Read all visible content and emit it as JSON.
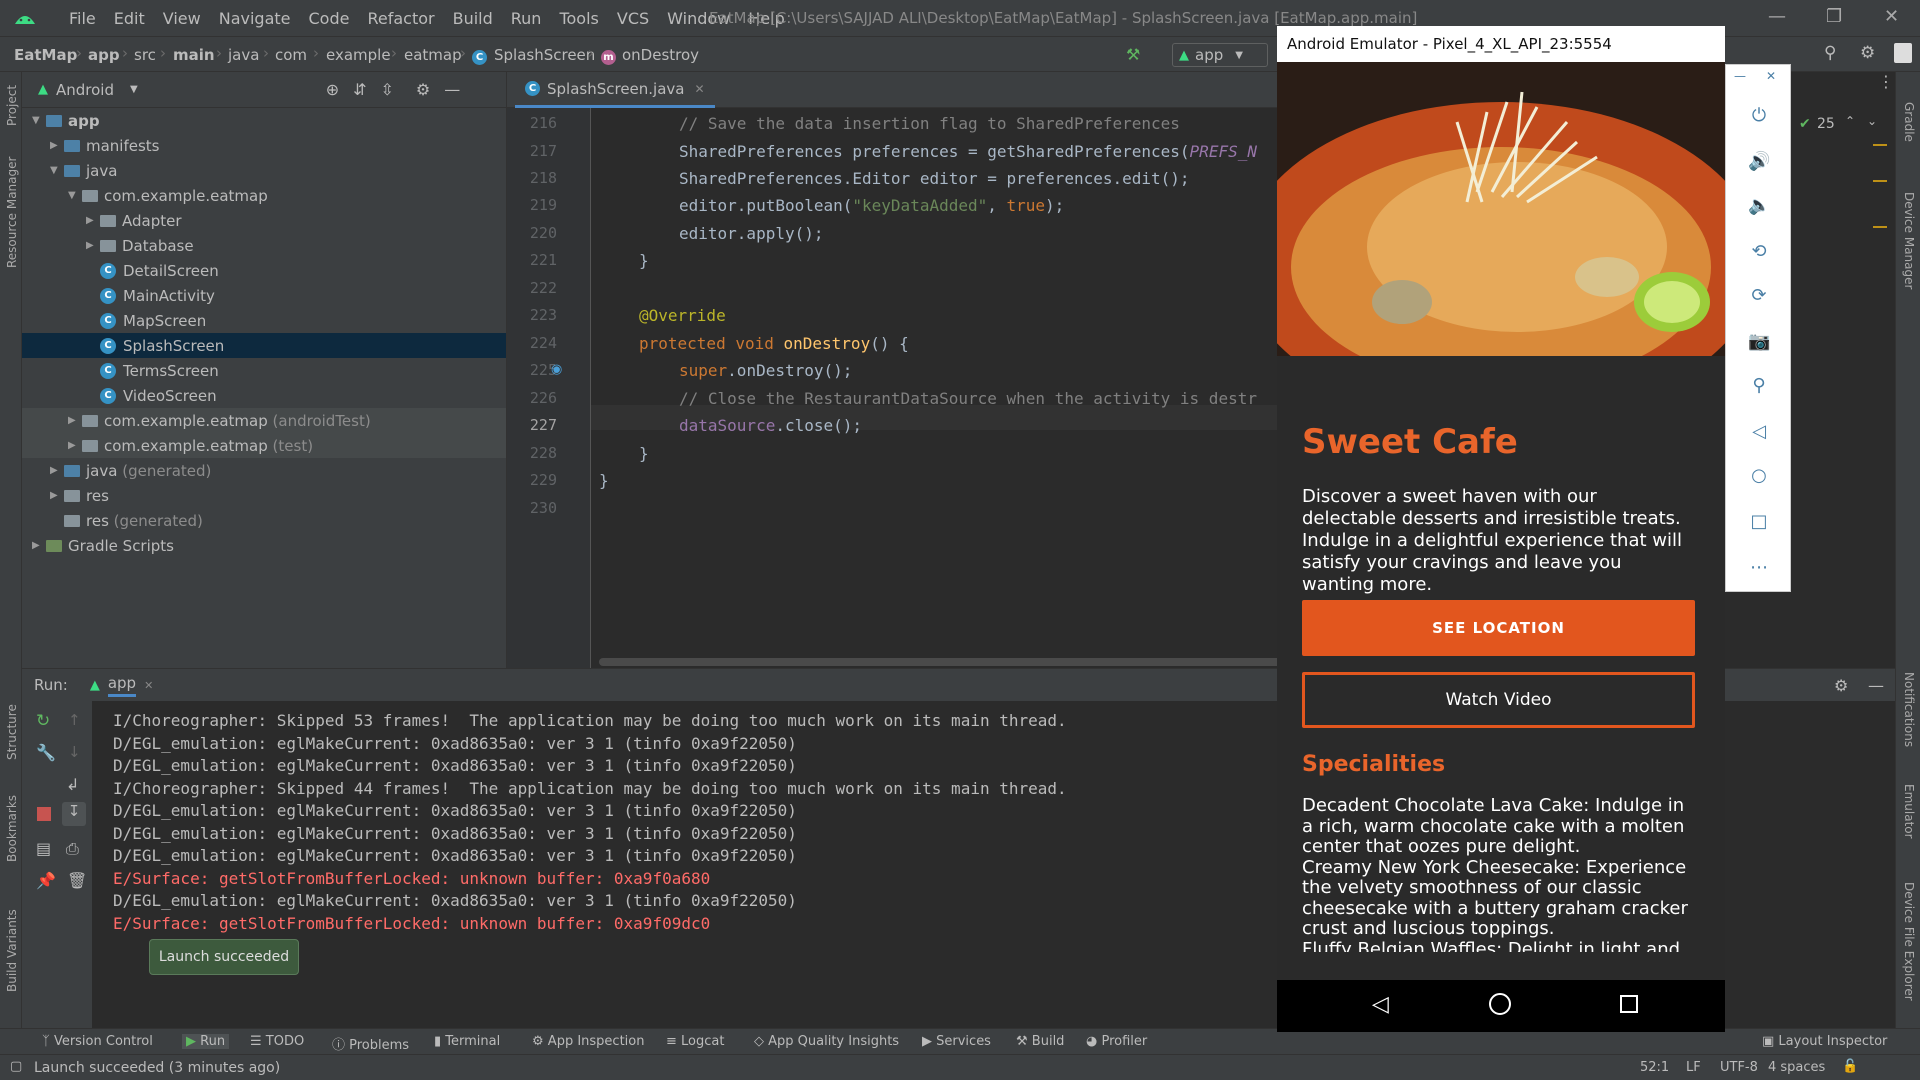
{
  "menubar": {
    "items": [
      "File",
      "Edit",
      "View",
      "Navigate",
      "Code",
      "Refactor",
      "Build",
      "Run",
      "Tools",
      "VCS",
      "Window",
      "Help"
    ],
    "window_title": "EatMap [C:\\Users\\SAJJAD ALI\\Desktop\\EatMap\\EatMap] - SplashScreen.java [EatMap.app.main]"
  },
  "breadcrumb": {
    "items": [
      "EatMap",
      "app",
      "src",
      "main",
      "java",
      "com",
      "example",
      "eatmap",
      "SplashScreen",
      "onDestroy"
    ],
    "run_config": "app"
  },
  "project": {
    "view_label": "Android",
    "tree": [
      {
        "label": "app",
        "depth": 0,
        "type": "module"
      },
      {
        "label": "manifests",
        "depth": 1,
        "type": "folder"
      },
      {
        "label": "java",
        "depth": 1,
        "type": "folder"
      },
      {
        "label": "com.example.eatmap",
        "depth": 2,
        "type": "package"
      },
      {
        "label": "Adapter",
        "depth": 3,
        "type": "package"
      },
      {
        "label": "Database",
        "depth": 3,
        "type": "package"
      },
      {
        "label": "DetailScreen",
        "depth": 3,
        "type": "class"
      },
      {
        "label": "MainActivity",
        "depth": 3,
        "type": "class"
      },
      {
        "label": "MapScreen",
        "depth": 3,
        "type": "class"
      },
      {
        "label": "SplashScreen",
        "depth": 3,
        "type": "class"
      },
      {
        "label": "TermsScreen",
        "depth": 3,
        "type": "class"
      },
      {
        "label": "VideoScreen",
        "depth": 3,
        "type": "class"
      },
      {
        "label": "com.example.eatmap",
        "suffix": "(androidTest)",
        "depth": 2,
        "type": "package"
      },
      {
        "label": "com.example.eatmap",
        "suffix": "(test)",
        "depth": 2,
        "type": "package"
      },
      {
        "label": "java",
        "suffix": "(generated)",
        "depth": 1,
        "type": "folder"
      },
      {
        "label": "res",
        "depth": 1,
        "type": "folder"
      },
      {
        "label": "res",
        "suffix": "(generated)",
        "depth": 1,
        "type": "folder"
      },
      {
        "label": "Gradle Scripts",
        "depth": 0,
        "type": "gradle"
      }
    ]
  },
  "editor": {
    "tab_label": "SplashScreen.java",
    "line_numbers": [
      "216",
      "217",
      "218",
      "219",
      "220",
      "221",
      "222",
      "223",
      "224",
      "225",
      "226",
      "227",
      "228",
      "229",
      "230"
    ],
    "inspection_count": "25"
  },
  "run": {
    "label": "Run:",
    "config": "app",
    "log": [
      {
        "level": "I",
        "text": "I/Choreographer: Skipped 53 frames!  The application may be doing too much work on its main thread."
      },
      {
        "level": "D",
        "text": "D/EGL_emulation: eglMakeCurrent: 0xad8635a0: ver 3 1 (tinfo 0xa9f22050)"
      },
      {
        "level": "D",
        "text": "D/EGL_emulation: eglMakeCurrent: 0xad8635a0: ver 3 1 (tinfo 0xa9f22050)"
      },
      {
        "level": "I",
        "text": "I/Choreographer: Skipped 44 frames!  The application may be doing too much work on its main thread."
      },
      {
        "level": "D",
        "text": "D/EGL_emulation: eglMakeCurrent: 0xad8635a0: ver 3 1 (tinfo 0xa9f22050)"
      },
      {
        "level": "D",
        "text": "D/EGL_emulation: eglMakeCurrent: 0xad8635a0: ver 3 1 (tinfo 0xa9f22050)"
      },
      {
        "level": "D",
        "text": "D/EGL_emulation: eglMakeCurrent: 0xad8635a0: ver 3 1 (tinfo 0xa9f22050)"
      },
      {
        "level": "E",
        "text": "E/Surface: getSlotFromBufferLocked: unknown buffer: 0xa9f0a680"
      },
      {
        "level": "D",
        "text": "D/EGL_emulation: eglMakeCurrent: 0xad8635a0: ver 3 1 (tinfo 0xa9f22050)"
      },
      {
        "level": "E",
        "text": "E/Surface: getSlotFromBufferLocked: unknown buffer: 0xa9f09dc0"
      }
    ],
    "toast": "Launch succeeded"
  },
  "tool_windows": [
    "Version Control",
    "Run",
    "TODO",
    "Problems",
    "Terminal",
    "App Inspection",
    "Logcat",
    "App Quality Insights",
    "Services",
    "Build",
    "Profiler"
  ],
  "layout_inspector": "Layout Inspector",
  "left_strip": [
    "Project",
    "Resource Manager",
    "Structure",
    "Bookmarks",
    "Build Variants"
  ],
  "right_strip": [
    "Gradle",
    "Device Manager",
    "Notifications",
    "Emulator",
    "Device File Explorer"
  ],
  "status": {
    "message": "Launch succeeded (3 minutes ago)",
    "position": "52:1",
    "line_sep": "LF",
    "encoding": "UTF-8",
    "indent": "4 spaces"
  },
  "emulator": {
    "title": "Android Emulator - Pixel_4_XL_API_23:5554",
    "app": {
      "title": "Sweet Cafe",
      "description": "Discover a sweet haven with our delectable desserts and irresistible treats. Indulge in a delightful experience that will satisfy your cravings and leave you wanting more.",
      "location_button": "SEE LOCATION",
      "video_button": "Watch Video",
      "specialities_title": "Specialities",
      "specialities": "Decadent Chocolate Lava Cake: Indulge in a rich, warm chocolate cake with a molten center that oozes pure delight.\nCreamy New York Cheesecake: Experience the velvety smoothness of our classic cheesecake with a buttery graham cracker crust and luscious toppings.\nFluffy Belgian Waffles: Delight in light and fluffy"
    }
  },
  "colors": {
    "accent": "#e2561e",
    "title": "#e9652b",
    "ide_bg": "#2b2b2b",
    "panel": "#3c3f41",
    "error": "#ff6b68"
  }
}
